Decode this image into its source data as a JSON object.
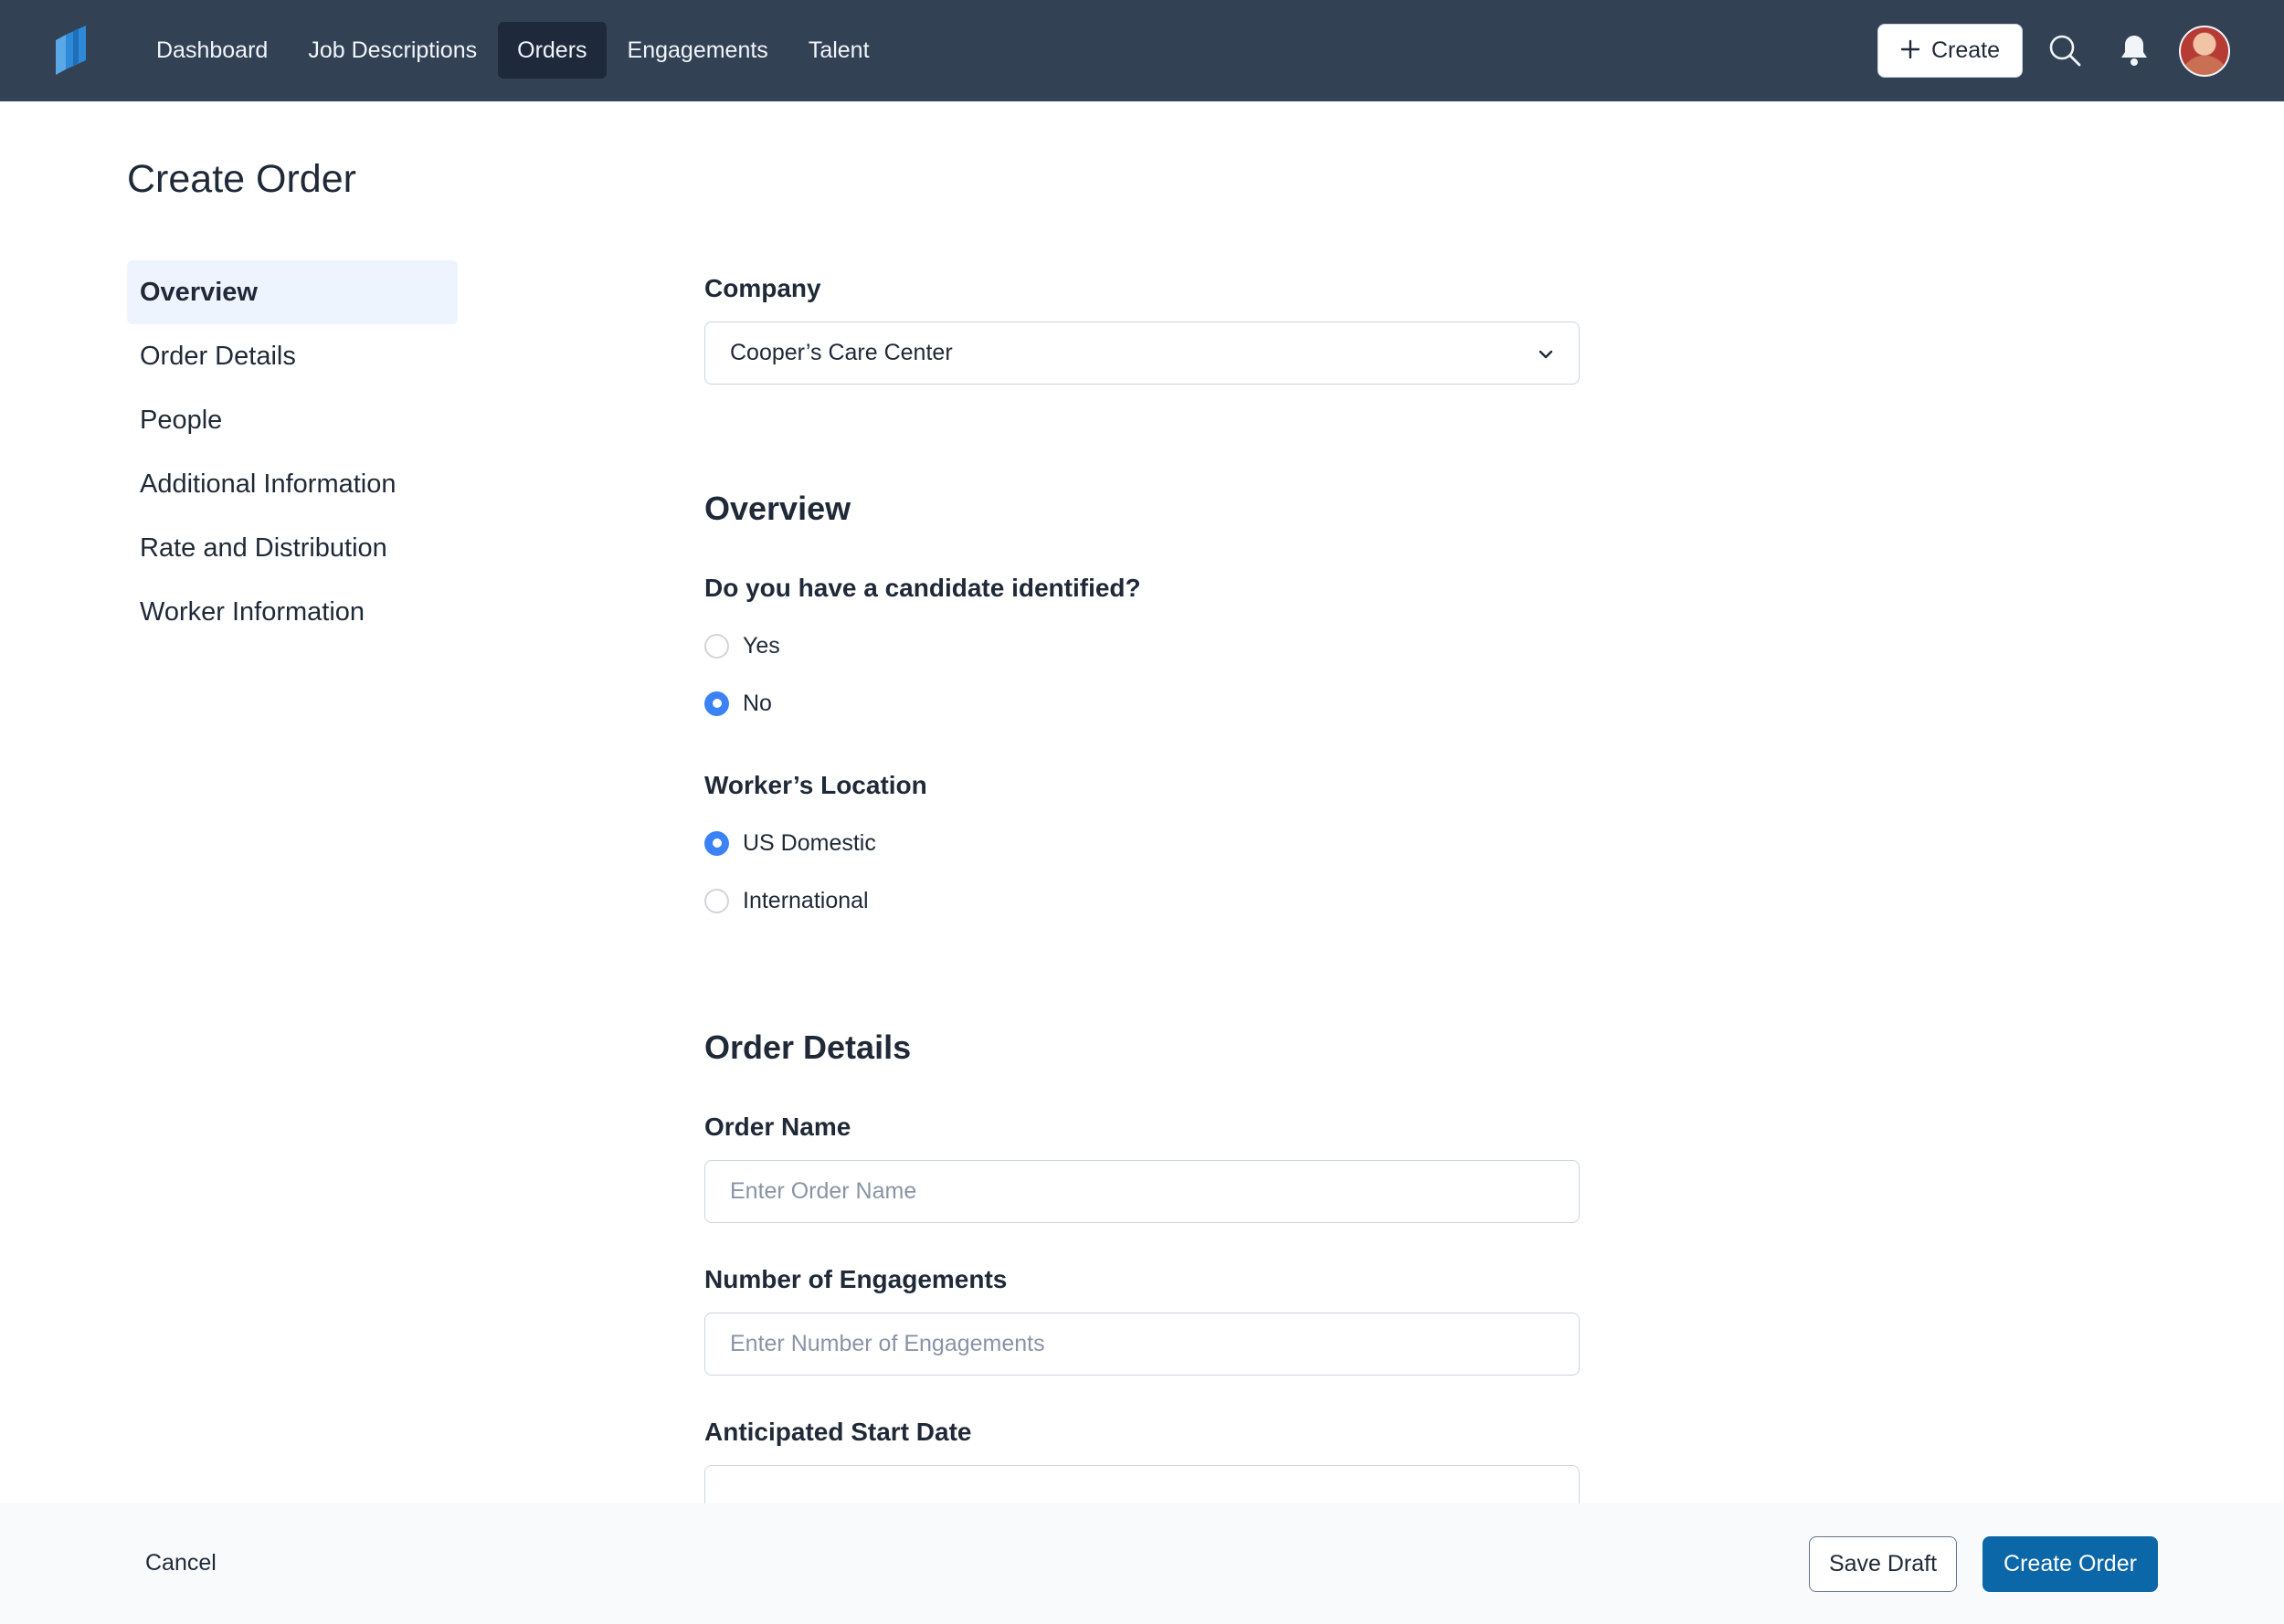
{
  "nav": {
    "items": [
      {
        "label": "Dashboard",
        "active": false
      },
      {
        "label": "Job Descriptions",
        "active": false
      },
      {
        "label": "Orders",
        "active": true
      },
      {
        "label": "Engagements",
        "active": false
      },
      {
        "label": "Talent",
        "active": false
      }
    ],
    "create_label": "Create",
    "icons": [
      "logo-icon",
      "plus-icon",
      "search-icon",
      "bell-icon",
      "avatar"
    ]
  },
  "page": {
    "title": "Create Order"
  },
  "sidenav": {
    "items": [
      {
        "label": "Overview",
        "active": true
      },
      {
        "label": "Order Details",
        "active": false
      },
      {
        "label": "People",
        "active": false
      },
      {
        "label": "Additional Information",
        "active": false
      },
      {
        "label": "Rate and Distribution",
        "active": false
      },
      {
        "label": "Worker Information",
        "active": false
      }
    ]
  },
  "form": {
    "company": {
      "label": "Company",
      "value": "Cooper’s Care Center"
    },
    "overview": {
      "heading": "Overview",
      "candidate_question": "Do you have a candidate identified?",
      "candidate_options": [
        {
          "label": "Yes",
          "checked": false
        },
        {
          "label": "No",
          "checked": true
        }
      ],
      "location_label": "Worker’s Location",
      "location_options": [
        {
          "label": "US Domestic",
          "checked": true
        },
        {
          "label": "International",
          "checked": false
        }
      ]
    },
    "order_details": {
      "heading": "Order Details",
      "order_name_label": "Order Name",
      "order_name_placeholder": "Enter Order Name",
      "engagements_label": "Number of Engagements",
      "engagements_placeholder": "Enter Number of Engagements",
      "start_date_label": "Anticipated Start Date"
    }
  },
  "footer": {
    "cancel_label": "Cancel",
    "save_draft_label": "Save Draft",
    "create_order_label": "Create Order"
  },
  "colors": {
    "nav_bg": "#334155",
    "nav_active_bg": "#1e293b",
    "primary": "#0b67a8",
    "radio_checked": "#3b82f6",
    "sidenav_active_bg": "#eef4fd"
  }
}
